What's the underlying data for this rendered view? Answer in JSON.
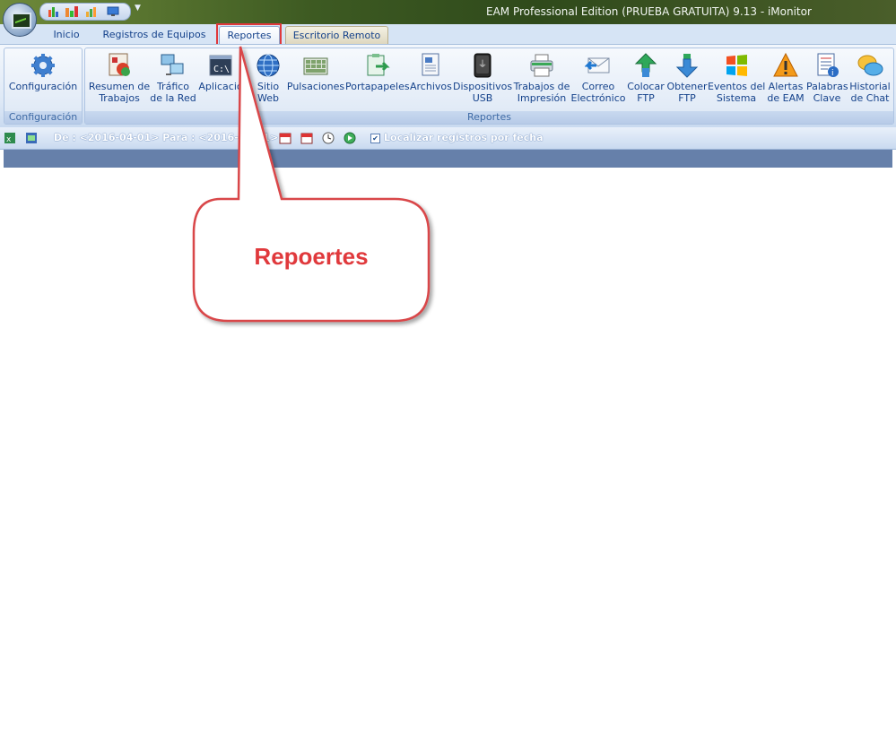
{
  "window": {
    "title": "EAM Professional Edition (PRUEBA GRATUITA) 9.13 - iMonitor"
  },
  "tabs": [
    {
      "label": "Inicio"
    },
    {
      "label": "Registros de Equipos"
    },
    {
      "label": "Reportes"
    },
    {
      "label": "Escritorio Remoto"
    }
  ],
  "ribbon": {
    "config_group": {
      "label": "Configuración",
      "button": "Configuración"
    },
    "reports_group": {
      "label": "Reportes",
      "buttons": [
        {
          "label": "Resumen de\nTrabajos",
          "icon": "work-summary-icon"
        },
        {
          "label": "Tráfico\nde la Red",
          "icon": "network-traffic-icon"
        },
        {
          "label": "Aplicació",
          "icon": "application-icon"
        },
        {
          "label": "Sitio\nWeb",
          "icon": "globe-icon"
        },
        {
          "label": "Pulsaciones",
          "icon": "keyboard-icon"
        },
        {
          "label": "Portapapeles",
          "icon": "clipboard-icon"
        },
        {
          "label": "Archivos",
          "icon": "file-icon"
        },
        {
          "label": "Dispositivos\nUSB",
          "icon": "usb-icon"
        },
        {
          "label": "Trabajos de\nImpresión",
          "icon": "printer-icon"
        },
        {
          "label": "Correo\nElectrónico",
          "icon": "mail-icon"
        },
        {
          "label": "Colocar\nFTP",
          "icon": "upload-icon"
        },
        {
          "label": "Obtener\nFTP",
          "icon": "download-icon"
        },
        {
          "label": "Eventos del\nSistema",
          "icon": "windows-logo-icon"
        },
        {
          "label": "Alertas\nde EAM",
          "icon": "warning-icon"
        },
        {
          "label": "Palabras\nClave",
          "icon": "keywords-icon"
        },
        {
          "label": "Historial\nde Chat",
          "icon": "chat-icon"
        }
      ]
    }
  },
  "toolbar": {
    "range": "De : <2016-04-01> Para : <2016-04-01>",
    "locate_checkbox": {
      "checked": true,
      "label": "Localizar registros por fecha"
    }
  },
  "callout": {
    "text": "Repoertes"
  }
}
